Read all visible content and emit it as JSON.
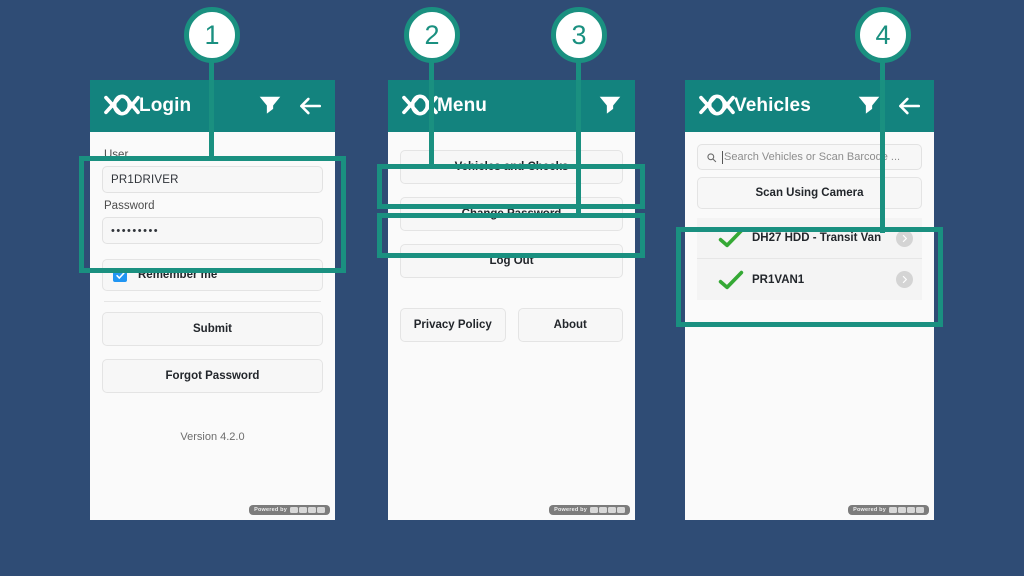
{
  "background_color": "#2f4c75",
  "accent_color": "#1a9080",
  "appbar_color": "#13837e",
  "callouts": [
    {
      "number": "1"
    },
    {
      "number": "2"
    },
    {
      "number": "3"
    },
    {
      "number": "4"
    }
  ],
  "panels": {
    "login": {
      "appbar": {
        "title": "Login",
        "logo_icon": "brand-logo-icon",
        "filter_icon": "filter-funnel-icon",
        "back_icon": "back-arrow-icon"
      },
      "user_label": "User",
      "user_value": "PR1DRIVER",
      "password_label": "Password",
      "password_value": "•••••••••",
      "remember_me_label": "Remember me",
      "remember_me_checked": true,
      "submit_label": "Submit",
      "forgot_password_label": "Forgot Password",
      "version_label": "Version 4.2.0",
      "powered_by_label": "Powered by"
    },
    "menu": {
      "appbar": {
        "title": "Menu",
        "logo_icon": "brand-logo-icon",
        "filter_icon": "filter-funnel-icon"
      },
      "vehicles_and_checks_label": "Vehicles and Checks",
      "change_password_label": "Change Password",
      "log_out_label": "Log Out",
      "privacy_policy_label": "Privacy Policy",
      "about_label": "About",
      "powered_by_label": "Powered by"
    },
    "vehicles": {
      "appbar": {
        "title": "Vehicles",
        "logo_icon": "brand-logo-icon",
        "filter_icon": "filter-funnel-icon",
        "back_icon": "back-arrow-icon"
      },
      "search_placeholder": "Search Vehicles or Scan Barcode ...",
      "search_icon": "magnifier-icon",
      "scan_using_camera_label": "Scan Using Camera",
      "rows": [
        {
          "name": "DH27 HDD - Transit Van",
          "status_icon": "green-check-icon",
          "chevron_icon": "chevron-right-icon"
        },
        {
          "name": "PR1VAN1",
          "status_icon": "green-check-icon",
          "chevron_icon": "chevron-right-icon"
        }
      ],
      "powered_by_label": "Powered by"
    }
  }
}
